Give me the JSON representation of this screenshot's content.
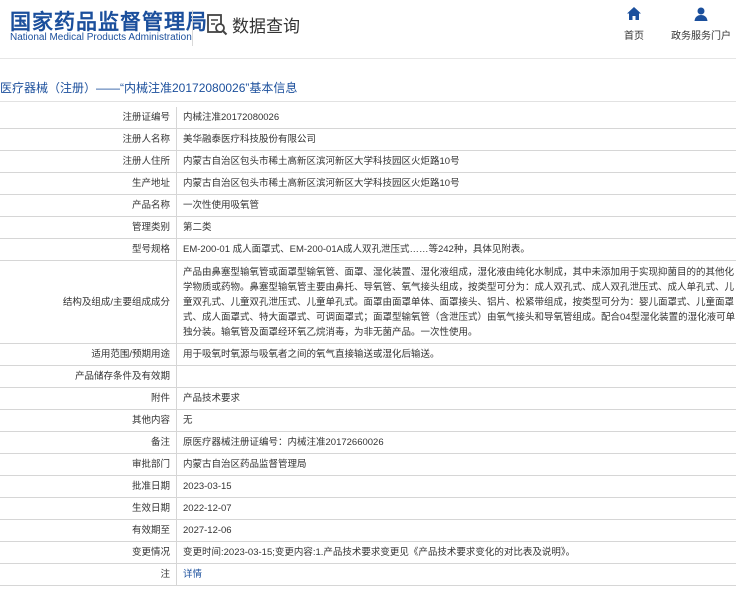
{
  "header": {
    "logo_cn": "国家药品监督管理局",
    "logo_en": "National Medical Products Administration",
    "query_label": "数据查询",
    "nav": {
      "home": "首页",
      "portal": "政务服务门户"
    }
  },
  "title": "医疗器械（注册）——“内械注准20172080026”基本信息",
  "rows": [
    {
      "label": "注册证编号",
      "value": "内械注准20172080026"
    },
    {
      "label": "注册人名称",
      "value": "美华融泰医疗科技股份有限公司"
    },
    {
      "label": "注册人住所",
      "value": "内蒙古自治区包头市稀土高新区滨河新区大学科技园区火炬路10号"
    },
    {
      "label": "生产地址",
      "value": "内蒙古自治区包头市稀土高新区滨河新区大学科技园区火炬路10号"
    },
    {
      "label": "产品名称",
      "value": "一次性使用吸氧管"
    },
    {
      "label": "管理类别",
      "value": "第二类"
    },
    {
      "label": "型号规格",
      "value": "EM-200-01 成人面罩式、EM-200-01A成人双孔泄压式……等242种，具体见附表。"
    },
    {
      "label": "结构及组成/主要组成成分",
      "value": "产品由鼻塞型输氧管或面罩型输氧管、面罩、湿化装置、湿化液组成，湿化液由纯化水制成，其中未添加用于实现抑菌目的的其他化学物质或药物。鼻塞型输氧管主要由鼻托、导氧管、氧气接头组成，按类型可分为：成人双孔式、成人双孔泄压式、成人单孔式、儿童双孔式、儿童双孔泄压式、儿童单孔式。面罩由面罩单体、面罩接头、铝片、松紧带组成，按类型可分为：婴儿面罩式、儿童面罩式、成人面罩式、特大面罩式、可调面罩式；面罩型输氧管（含泄压式）由氧气接头和导氧管组成。配合04型湿化装置的湿化液可单独分装。输氧管及面罩经环氧乙烷消毒，为非无菌产品。一次性使用。"
    },
    {
      "label": "适用范围/预期用途",
      "value": "用于吸氧时氧源与吸氧者之间的氧气直接输送或湿化后输送。"
    },
    {
      "label": "产品储存条件及有效期",
      "value": ""
    },
    {
      "label": "附件",
      "value": "产品技术要求"
    },
    {
      "label": "其他内容",
      "value": "无"
    },
    {
      "label": "备注",
      "value": "原医疗器械注册证编号：内械注准20172660026"
    },
    {
      "label": "审批部门",
      "value": "内蒙古自治区药品监督管理局"
    },
    {
      "label": "批准日期",
      "value": "2023-03-15"
    },
    {
      "label": "生效日期",
      "value": "2022-12-07"
    },
    {
      "label": "有效期至",
      "value": "2027-12-06"
    },
    {
      "label": "变更情况",
      "value": "变更时间:2023-03-15;变更内容:1.产品技术要求变更见《产品技术要求变化的对比表及说明》。"
    },
    {
      "label": "注",
      "value": "详情"
    }
  ]
}
